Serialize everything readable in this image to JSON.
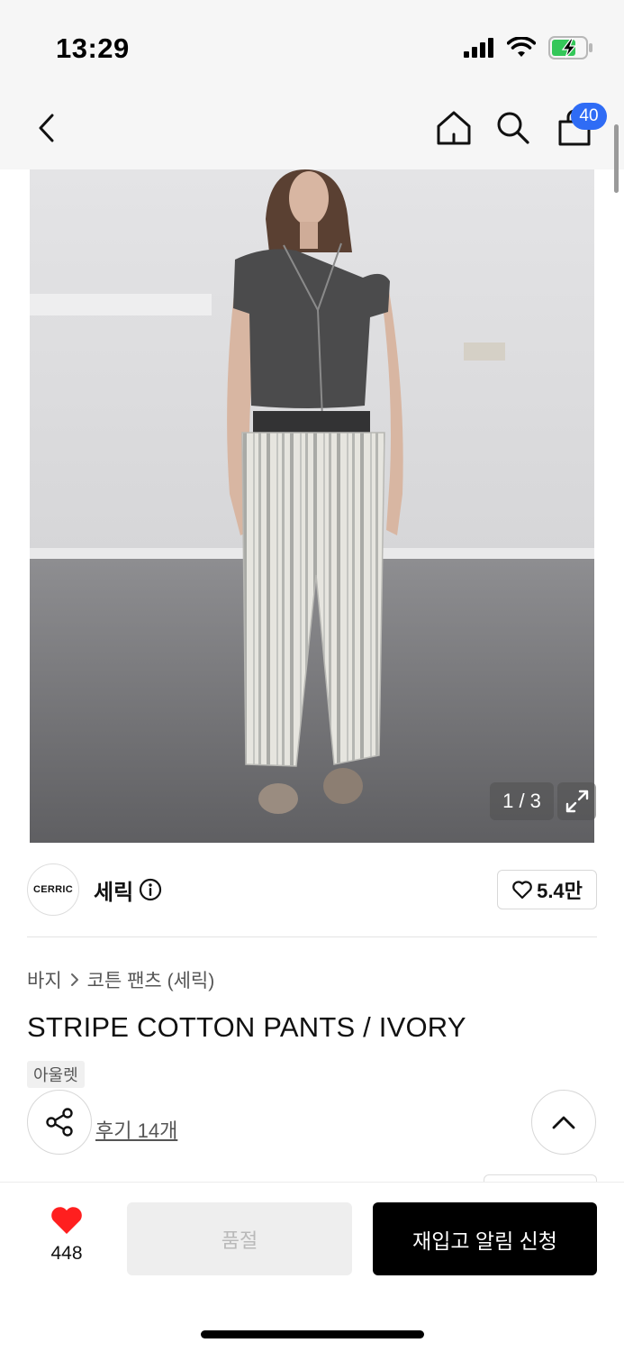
{
  "status_bar": {
    "time": "13:29"
  },
  "header": {
    "cart_count": "40"
  },
  "gallery": {
    "counter": "1 / 3"
  },
  "brand": {
    "logo_text": "CERRIC",
    "name": "세릭",
    "like_count": "5.4만"
  },
  "product": {
    "breadcrumb": {
      "category": "바지",
      "subcategory": "코튼 팬츠 (세릭)"
    },
    "title": "STRIPE COTTON PANTS / IVORY",
    "tag": "아울렛",
    "reviews": "후기 14개"
  },
  "bottom_bar": {
    "heart_count": "448",
    "soldout_label": "품절",
    "restock_label": "재입고 알림 신청"
  },
  "colors": {
    "badge": "#2f6cf5",
    "heart": "#ff1f1f",
    "primary_button": "#000000"
  }
}
